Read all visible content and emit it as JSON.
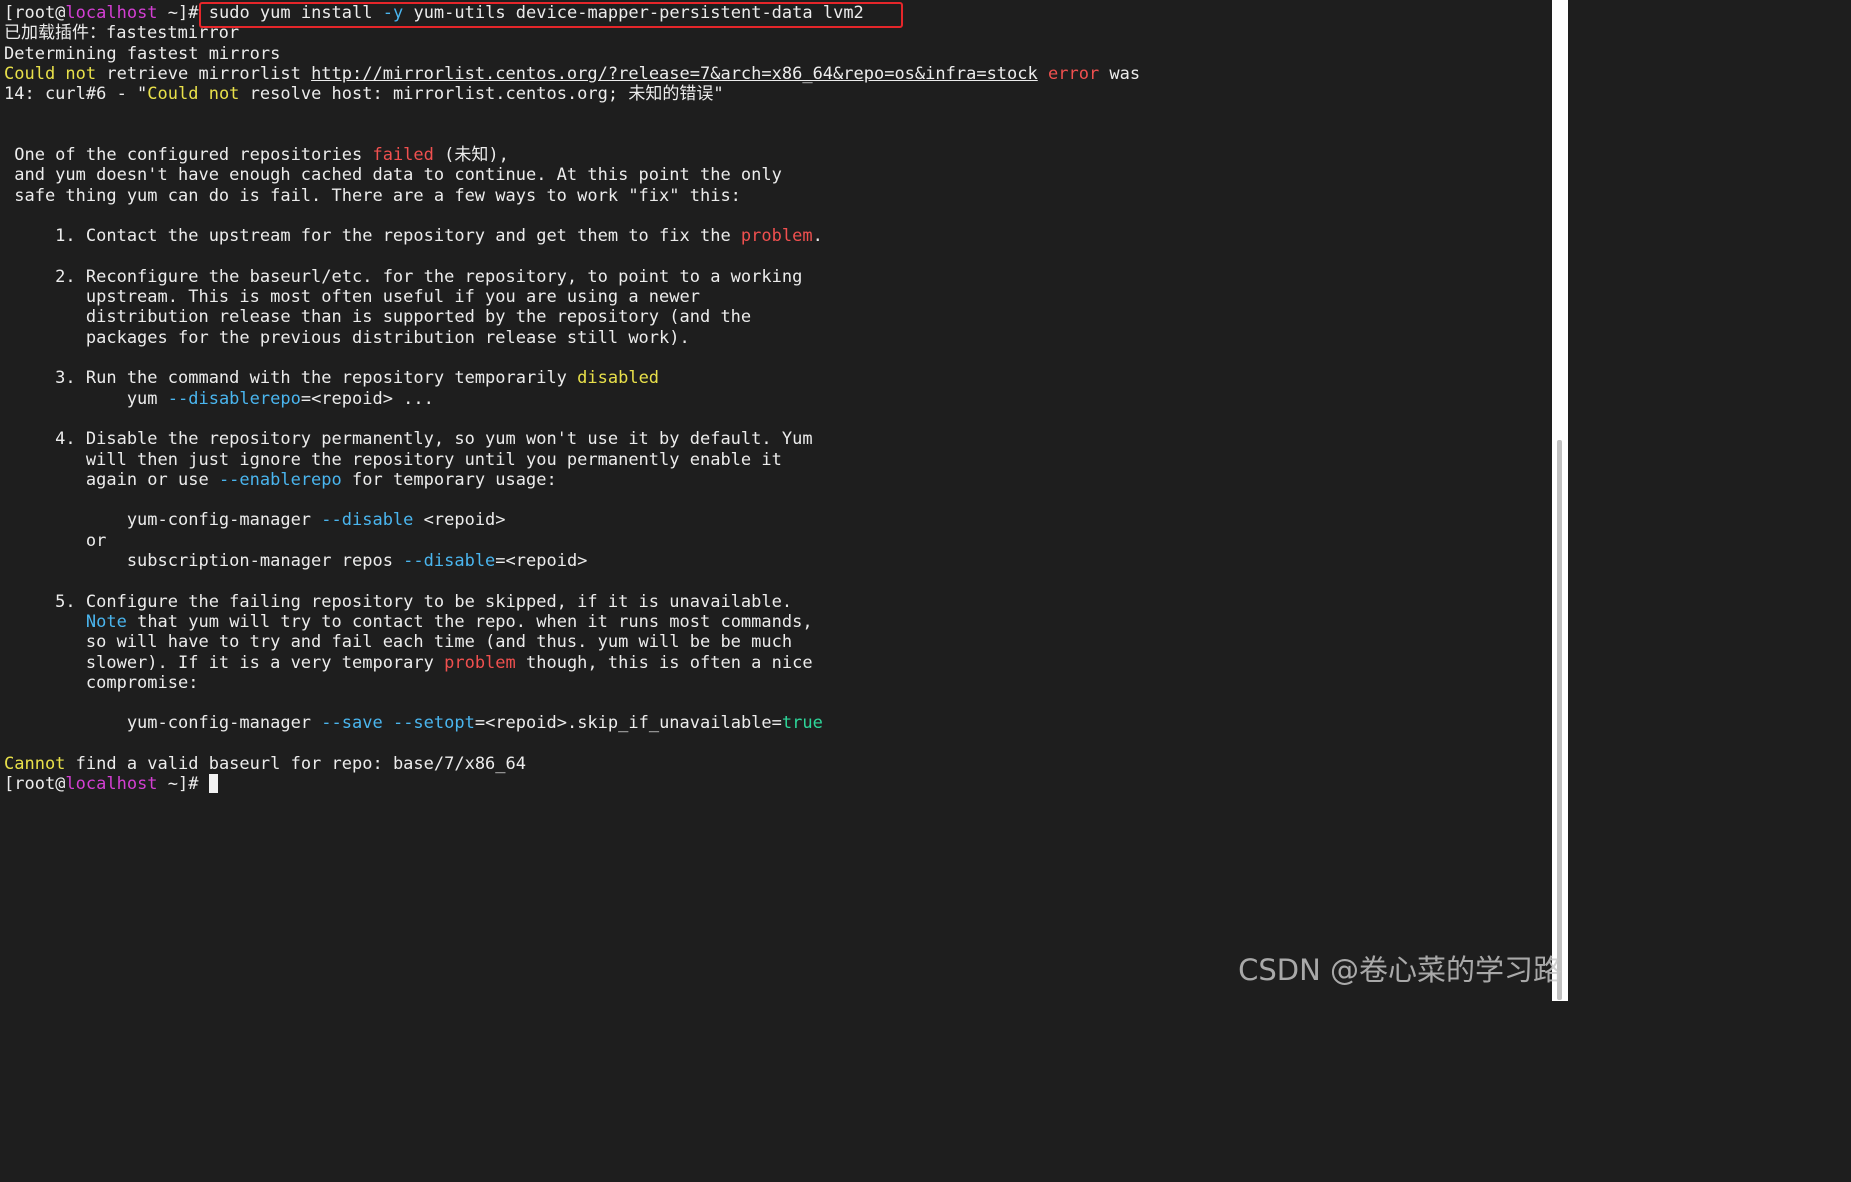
{
  "terminal": {
    "prompt": {
      "open": "[root@",
      "host": "localhost",
      "close": " ~]# "
    },
    "command": "sudo yum install -y yum-utils device-mapper-persistent-data lvm2",
    "lines": [
      [
        {
          "t": "[root@"
        },
        {
          "t": "localhost",
          "c": "magenta"
        },
        {
          "t": " ~]# "
        },
        {
          "t": "sudo yum install "
        },
        {
          "t": "-y",
          "c": "cyan"
        },
        {
          "t": " yum-utils device-mapper-persistent-data lvm2"
        }
      ],
      [
        {
          "t": "已加载插件：fastestmirror"
        }
      ],
      [
        {
          "t": "Determining fastest mirrors"
        }
      ],
      [
        {
          "t": "Could not",
          "c": "yellow"
        },
        {
          "t": " retrieve mirrorlist "
        },
        {
          "t": "http://mirrorlist.centos.org/?release=7&arch=x86_64&repo=os&infra=stock",
          "u": true
        },
        {
          "t": " "
        },
        {
          "t": "error",
          "c": "red"
        },
        {
          "t": " was"
        }
      ],
      [
        {
          "t": "14: curl#6 - \""
        },
        {
          "t": "Could not",
          "c": "yellow"
        },
        {
          "t": " resolve host: mirrorlist.centos.org; 未知的错误\""
        }
      ],
      [],
      [],
      [
        {
          "t": " One of the configured repositories "
        },
        {
          "t": "failed",
          "c": "red"
        },
        {
          "t": " (未知),"
        }
      ],
      [
        {
          "t": " and yum doesn't have enough cached data to continue. At this point the only"
        }
      ],
      [
        {
          "t": " safe thing yum can do is fail. There are a few ways to work \"fix\" this:"
        }
      ],
      [],
      [
        {
          "t": "     1. Contact the upstream for the repository and get them to fix the "
        },
        {
          "t": "problem",
          "c": "red"
        },
        {
          "t": "."
        }
      ],
      [],
      [
        {
          "t": "     2. Reconfigure the baseurl/etc. for the repository, to point to a working"
        }
      ],
      [
        {
          "t": "        upstream. This is most often useful if you are using a newer"
        }
      ],
      [
        {
          "t": "        distribution release than is supported by the repository (and the"
        }
      ],
      [
        {
          "t": "        packages for the previous distribution release still work)."
        }
      ],
      [],
      [
        {
          "t": "     3. Run the command with the repository temporarily "
        },
        {
          "t": "disabled",
          "c": "yellow"
        }
      ],
      [
        {
          "t": "            yum "
        },
        {
          "t": "--disablerepo",
          "c": "cyan"
        },
        {
          "t": "=<repoid> ..."
        }
      ],
      [],
      [
        {
          "t": "     4. Disable the repository permanently, so yum won't use it by default. Yum"
        }
      ],
      [
        {
          "t": "        will then just ignore the repository until you permanently enable it"
        }
      ],
      [
        {
          "t": "        again or use "
        },
        {
          "t": "--enablerepo",
          "c": "cyan"
        },
        {
          "t": " for temporary usage:"
        }
      ],
      [],
      [
        {
          "t": "            yum-config-manager "
        },
        {
          "t": "--disable",
          "c": "cyan"
        },
        {
          "t": " <repoid>"
        }
      ],
      [
        {
          "t": "        or"
        }
      ],
      [
        {
          "t": "            subscription-manager repos "
        },
        {
          "t": "--disable",
          "c": "cyan"
        },
        {
          "t": "=<repoid>"
        }
      ],
      [],
      [
        {
          "t": "     5. Configure the failing repository to be skipped, if it is unavailable."
        }
      ],
      [
        {
          "t": "        "
        },
        {
          "t": "Note",
          "c": "cyan"
        },
        {
          "t": " that yum will try to contact the repo. when it runs most commands,"
        }
      ],
      [
        {
          "t": "        so will have to try and fail each time (and thus. yum will be be much"
        }
      ],
      [
        {
          "t": "        slower). If it is a very temporary "
        },
        {
          "t": "problem",
          "c": "red"
        },
        {
          "t": " though, this is often a nice"
        }
      ],
      [
        {
          "t": "        compromise:"
        }
      ],
      [],
      [
        {
          "t": "            yum-config-manager "
        },
        {
          "t": "--save",
          "c": "cyan"
        },
        {
          "t": " "
        },
        {
          "t": "--setopt",
          "c": "cyan"
        },
        {
          "t": "=<repoid>.skip_if_unavailable="
        },
        {
          "t": "true",
          "c": "green"
        }
      ],
      [],
      [
        {
          "t": "Cannot",
          "c": "yellow"
        },
        {
          "t": " find a valid baseurl for repo: base/7/x86_64"
        }
      ],
      [
        {
          "t": "[root@"
        },
        {
          "t": "localhost",
          "c": "magenta"
        },
        {
          "t": " ~]# "
        },
        {
          "cursor": true
        }
      ]
    ]
  },
  "colors": {
    "background": "#1e1e1e",
    "foreground": "#ececec",
    "magenta": "#d33fd3",
    "yellow": "#e8e04a",
    "red": "#f0504f",
    "cyan": "#4ab5ee",
    "green": "#2ed69a",
    "highlight_box": "#e5262a"
  },
  "watermark": "CSDN @卷心菜的学习路"
}
